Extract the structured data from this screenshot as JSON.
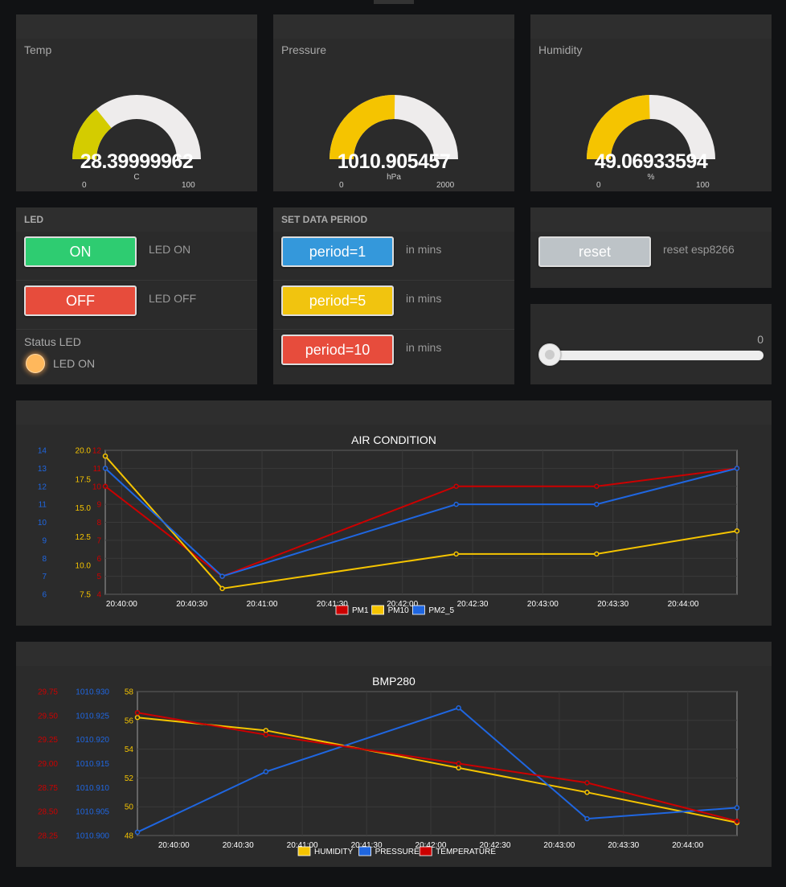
{
  "gauges": [
    {
      "title": "Temp",
      "value": "28.39999962",
      "unit": "C",
      "min": "0",
      "max": "100",
      "fraction": 0.284,
      "color": "#d4cc00"
    },
    {
      "title": "Pressure",
      "value": "1010.905457",
      "unit": "hPa",
      "min": "0",
      "max": "2000",
      "fraction": 0.505,
      "color": "#f5c400"
    },
    {
      "title": "Humidity",
      "value": "49.06933594",
      "unit": "%",
      "min": "0",
      "max": "100",
      "fraction": 0.491,
      "color": "#f5c400"
    }
  ],
  "led_group": {
    "title": "LED",
    "on_button": "ON",
    "on_label": "LED ON",
    "off_button": "OFF",
    "off_label": "LED OFF",
    "status_title": "Status LED",
    "status_text": "LED ON"
  },
  "period_group": {
    "title": "SET DATA PERIOD",
    "buttons": [
      {
        "label": "period=1",
        "unit": "in mins",
        "color": "#3498db"
      },
      {
        "label": "period=5",
        "unit": "in mins",
        "color": "#f1c40f"
      },
      {
        "label": "period=10",
        "unit": "in mins",
        "color": "#e74c3c"
      }
    ]
  },
  "reset": {
    "button": "reset",
    "label": "reset esp8266"
  },
  "slider": {
    "value": "0",
    "fraction": 0
  },
  "colors": {
    "on": "#2ecc71",
    "off": "#e74c3c",
    "reset": "#bdc3c7",
    "pm1": "#cc0000",
    "pm10": "#f5c400",
    "pm25": "#1f66e0"
  },
  "chart_data": [
    {
      "type": "line",
      "title": "AIR CONDITION",
      "x": [
        "20:39:53",
        "20:40:43",
        "20:42:23",
        "20:43:23",
        "20:44:23"
      ],
      "x_ticks": [
        "20:40:00",
        "20:40:30",
        "20:41:00",
        "20:41:30",
        "20:42:00",
        "20:42:30",
        "20:43:00",
        "20:43:30",
        "20:44:00"
      ],
      "axes": [
        {
          "id": "pm2_5",
          "color": "#1f66e0",
          "ylim": [
            6,
            14
          ],
          "ticks": [
            "14",
            "13",
            "12",
            "11",
            "10",
            "9",
            "8",
            "7",
            "6"
          ]
        },
        {
          "id": "pm10",
          "color": "#f5c400",
          "ylim": [
            7.5,
            20
          ],
          "ticks": [
            "20.0",
            "17.5",
            "15.0",
            "12.5",
            "10.0",
            "7.5"
          ]
        },
        {
          "id": "pm1",
          "color": "#cc0000",
          "ylim": [
            4,
            12
          ],
          "ticks": [
            "12",
            "11",
            "10",
            "9",
            "8",
            "7",
            "6",
            "5",
            "4"
          ]
        }
      ],
      "series": [
        {
          "name": "PM1",
          "axis": "pm1",
          "color": "#cc0000",
          "values": [
            10,
            5,
            10,
            10,
            11
          ]
        },
        {
          "name": "PM10",
          "axis": "pm10",
          "color": "#f5c400",
          "values": [
            19.5,
            8,
            11,
            11,
            13
          ]
        },
        {
          "name": "PM2_5",
          "axis": "pm2_5",
          "color": "#1f66e0",
          "values": [
            13,
            7,
            11,
            11,
            13
          ]
        }
      ],
      "legend": "bottom"
    },
    {
      "type": "line",
      "title": "BMP280",
      "x": [
        "20:39:43",
        "20:40:43",
        "20:42:13",
        "20:43:13",
        "20:44:23"
      ],
      "x_ticks": [
        "20:40:00",
        "20:40:30",
        "20:41:00",
        "20:41:30",
        "20:42:00",
        "20:42:30",
        "20:43:00",
        "20:43:30",
        "20:44:00"
      ],
      "axes": [
        {
          "id": "temperature",
          "color": "#cc0000",
          "ylim": [
            28.25,
            29.75
          ],
          "ticks": [
            "29.75",
            "29.50",
            "29.25",
            "29.00",
            "28.75",
            "28.50",
            "28.25"
          ]
        },
        {
          "id": "pressure",
          "color": "#1f66e0",
          "ylim": [
            1010.9,
            1010.93
          ],
          "ticks": [
            "1010.930",
            "1010.925",
            "1010.920",
            "1010.915",
            "1010.910",
            "1010.905",
            "1010.900"
          ]
        },
        {
          "id": "humidity",
          "color": "#f5c400",
          "ylim": [
            48,
            58
          ],
          "ticks": [
            "58",
            "56",
            "54",
            "52",
            "50",
            "48"
          ]
        }
      ],
      "series": [
        {
          "name": "HUMIDITY",
          "axis": "humidity",
          "color": "#f5c400",
          "values": [
            56.2,
            55.3,
            52.7,
            51.0,
            48.9
          ]
        },
        {
          "name": "PRESSURE",
          "axis": "pressure",
          "color": "#1f66e0",
          "values": [
            1010.9007,
            1010.9133,
            1010.9266,
            1010.9035,
            1010.9058
          ]
        },
        {
          "name": "TEMPERATURE",
          "axis": "temperature",
          "color": "#cc0000",
          "values": [
            29.53,
            29.3,
            29.0,
            28.8,
            28.4
          ]
        }
      ],
      "legend": "bottom"
    }
  ]
}
